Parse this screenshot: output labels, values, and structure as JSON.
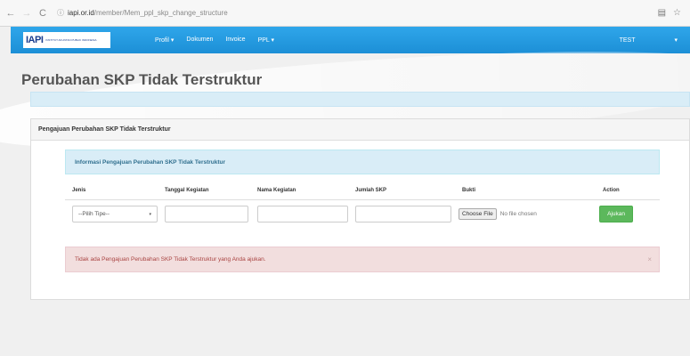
{
  "browser": {
    "back_icon": "←",
    "forward_icon": "→",
    "reload_icon": "C",
    "info_icon": "ⓘ",
    "url_domain": "iapi.or.id",
    "url_path": "/member/Mem_ppl_skp_change_structure",
    "ext_icon": "▤",
    "star_icon": "☆"
  },
  "navbar": {
    "logo_mark": "IAPI",
    "logo_text": "INSTITUT AKUNTAN PUBLIK INDONESIA",
    "menu": [
      "Profil ▾",
      "Dokumen",
      "Invoice",
      "PPL ▾"
    ],
    "user": "TEST",
    "caret": "▾"
  },
  "page": {
    "title": "Perubahan SKP Tidak Terstruktur"
  },
  "panel": {
    "heading": "Pengajuan Perubahan SKP Tidak Terstruktur",
    "info": "Informasi Pengajuan Perubahan SKP Tidak Terstruktur",
    "columns": [
      "Jenis",
      "Tanggal Kegiatan",
      "Nama Kegiatan",
      "Jumlah SKP",
      "Bukti",
      "Action"
    ],
    "select_value": "--Pilih Tipe--",
    "select_caret": "▾",
    "choose_file": "Choose File",
    "no_file": "No file chosen",
    "submit": "Ajukan",
    "alert": "Tidak ada Pengajuan Perubahan SKP Tidak Terstruktur yang Anda ajukan.",
    "alert_close": "×"
  },
  "colors": {
    "navbar": "#1c8fd6",
    "info_bg": "#d9edf7",
    "alert_bg": "#f2dede",
    "success": "#5cb85c"
  }
}
